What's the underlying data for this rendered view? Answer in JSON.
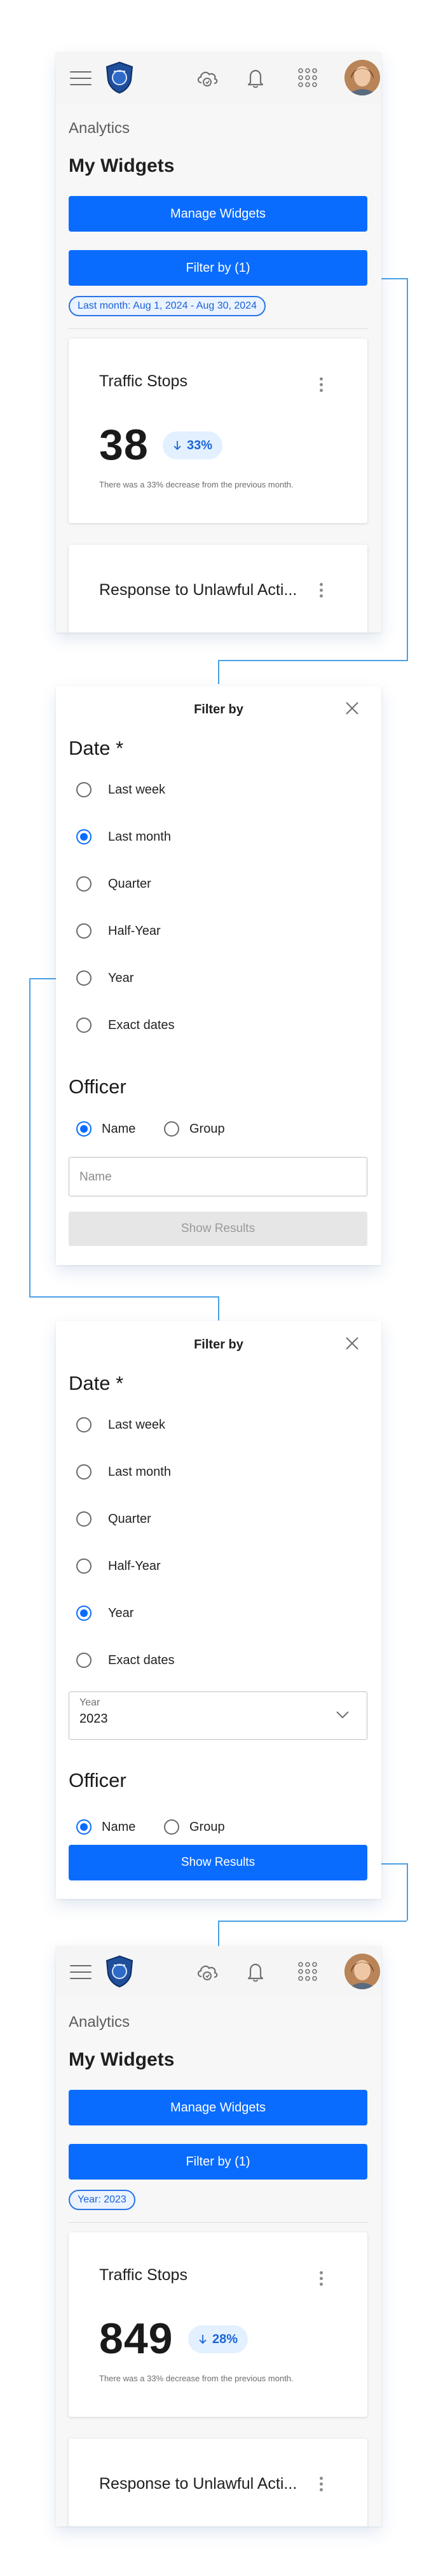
{
  "colors": {
    "accent": "#0a6cff",
    "connector": "#4aa0e6",
    "chip_border": "#2a73e6"
  },
  "icons": [
    "menu-icon",
    "agency-logo",
    "cloud-sync-icon",
    "bell-icon",
    "app-grid-icon",
    "user-avatar",
    "kebab-menu-icon",
    "arrow-down-icon",
    "close-icon",
    "chevron-down-icon"
  ],
  "screen1": {
    "breadcrumb": "Analytics",
    "page_title": "My Widgets",
    "manage_button": "Manage Widgets",
    "filter_button": "Filter by (1)",
    "active_filter_chip": "Last month: Aug 1, 2024 - Aug 30, 2024",
    "widget1": {
      "title": "Traffic Stops",
      "value": "38",
      "trend": "33%",
      "note": "There was a 33% decrease from the previous month."
    },
    "widget2": {
      "title": "Response to Unlawful Acti..."
    }
  },
  "screen2": {
    "title": "Filter by",
    "date_section": "Date *",
    "date_options": [
      "Last week",
      "Last month",
      "Quarter",
      "Half-Year",
      "Year",
      "Exact dates"
    ],
    "selected_date": "Last month",
    "officer_section": "Officer",
    "officer_options": [
      "Name",
      "Group"
    ],
    "selected_officer": "Name",
    "name_placeholder": "Name",
    "show_results": "Show Results"
  },
  "screen3": {
    "title": "Filter by",
    "date_section": "Date *",
    "date_options": [
      "Last week",
      "Last month",
      "Quarter",
      "Half-Year",
      "Year",
      "Exact dates"
    ],
    "selected_date": "Year",
    "year_field_label": "Year",
    "year_field_value": "2023",
    "officer_section": "Officer",
    "officer_options": [
      "Name",
      "Group"
    ],
    "selected_officer": "Name",
    "show_results": "Show Results"
  },
  "screen4": {
    "breadcrumb": "Analytics",
    "page_title": "My Widgets",
    "manage_button": "Manage Widgets",
    "filter_button": "Filter by (1)",
    "active_filter_chip": "Year: 2023",
    "widget1": {
      "title": "Traffic Stops",
      "value": "849",
      "trend": "28%",
      "note": "There was a 33% decrease from the previous month."
    },
    "widget2": {
      "title": "Response to Unlawful Acti..."
    }
  }
}
